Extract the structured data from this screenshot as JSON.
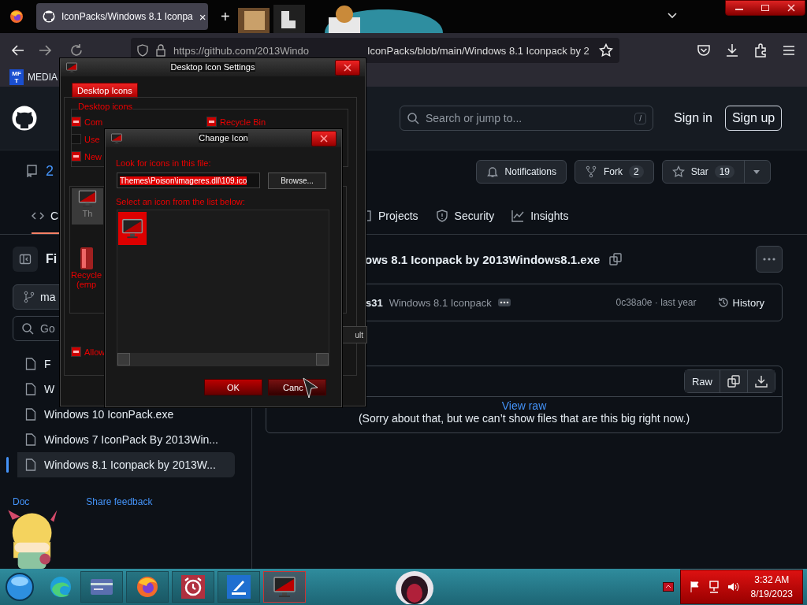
{
  "browser": {
    "tab": {
      "title": "IconPacks/Windows 8.1 Iconpa",
      "close": "×",
      "new_tab": "+"
    },
    "url_start": "https://github.com/2013Windo",
    "url_end": "IconPacks/blob/main/Windows 8.1 Iconpack by 2",
    "bookmark": {
      "badge_top": "MF",
      "badge_bottom": "T",
      "label": "MEDIA"
    }
  },
  "github": {
    "search": {
      "placeholder": "Search or jump to...",
      "shortcut": "/"
    },
    "sign_in": "Sign in",
    "sign_up": "Sign up",
    "repo_name": "2",
    "actions": [
      {
        "kind": "bell",
        "label": "Notifications"
      },
      {
        "kind": "fork",
        "label": "Fork",
        "count": "2"
      },
      {
        "kind": "star",
        "label": "Star",
        "count": "19"
      }
    ],
    "tabs": [
      {
        "kind": "code",
        "label": "C",
        "selected": true
      },
      {
        "kind": "projects",
        "label": "Projects",
        "selected": false
      },
      {
        "kind": "security",
        "label": "Security",
        "selected": false
      },
      {
        "kind": "insights",
        "label": "Insights",
        "selected": false
      }
    ],
    "sidebar": {
      "title": "Fi",
      "branch": "ma",
      "search": "Go",
      "files": [
        {
          "name": "F",
          "selected": false
        },
        {
          "name": "W",
          "selected": false
        },
        {
          "name": "Windows 10 IconPack.exe",
          "selected": false
        },
        {
          "name": "Windows 7 IconPack By 2013Win...",
          "selected": false
        },
        {
          "name": "Windows 8.1 Iconpack by 2013W...",
          "selected": true
        }
      ],
      "footer_link": "Doc",
      "feedback_link": "Share feedback"
    },
    "file": {
      "title": "ows 8.1 Iconpack by 2013Windows8.1.exe",
      "commit_author": "s31",
      "commit_message": "Windows 8.1 Iconpack",
      "commit_meta": "0c38a0e · last year",
      "history": "History",
      "raw": "Raw",
      "view_raw": "View raw",
      "notice": "(Sorry about that, but we can’t show files that are this big right now.)"
    }
  },
  "settings_dialog": {
    "title": "Desktop Icon Settings",
    "tab": "Desktop Icons",
    "group": "Desktop icons",
    "checkboxes": [
      {
        "label": "Com",
        "checked": true
      },
      {
        "label": "Use",
        "checked": false
      },
      {
        "label": "New",
        "checked": true
      },
      {
        "label": "Recycle Bin",
        "checked": true
      }
    ],
    "icon_this": "Th",
    "icon_recycle": [
      "Recycle",
      "(emp"
    ],
    "allow": {
      "label": "Allow",
      "checked": true
    },
    "default_button": "ult"
  },
  "change_icon_dialog": {
    "title": "Change Icon",
    "file_label": "Look for icons in this file:",
    "file_value": "Themes\\Poison\\imageres.dll\\109.ico",
    "browse": "Browse...",
    "list_label": "Select an icon from the list below:",
    "icons": [
      {
        "selected": true
      }
    ],
    "ok": "OK",
    "cancel": "Canc"
  },
  "taskbar": {
    "apps": [
      {
        "kind": "card",
        "selected": false
      },
      {
        "kind": "firefox",
        "selected": false
      },
      {
        "kind": "alarm",
        "selected": false
      },
      {
        "kind": "scanner",
        "selected": false
      },
      {
        "kind": "monitor",
        "selected": true
      }
    ],
    "time": "3:32 AM",
    "date": "8/19/2023"
  }
}
